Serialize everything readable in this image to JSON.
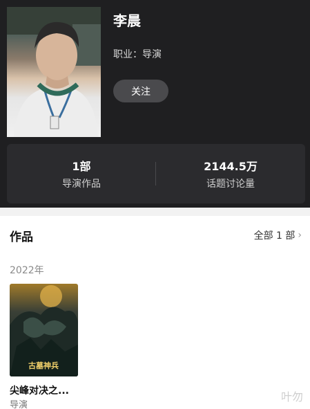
{
  "profile": {
    "name": "李晨",
    "occupation": "职业：导演",
    "follow_label": "关注"
  },
  "stats": [
    {
      "value": "1部",
      "label": "导演作品"
    },
    {
      "value": "2144.5万",
      "label": "话题讨论量"
    }
  ],
  "works": {
    "title": "作品",
    "all_label": "全部 1 部",
    "chevron": "›",
    "year": "2022年",
    "items": [
      {
        "title": "尖峰对决之...",
        "role": "导演"
      }
    ]
  },
  "watermark": "叶勿",
  "colors": {
    "header_bg": "#1f1f21",
    "stats_bg": "#2b2b2e",
    "follow_bg": "#4a4a4d"
  }
}
